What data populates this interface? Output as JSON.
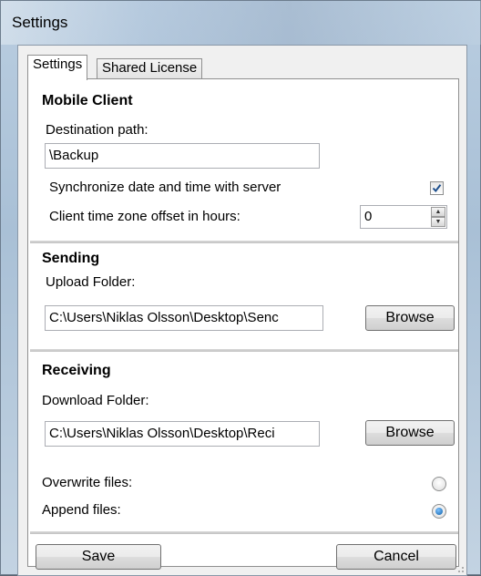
{
  "window": {
    "title": "Settings"
  },
  "tabs": [
    {
      "label": "Settings",
      "active": true
    },
    {
      "label": "Shared License",
      "active": false
    }
  ],
  "mobile_client": {
    "heading": "Mobile Client",
    "destination_label": "Destination path:",
    "destination_value": "\\Backup",
    "sync_label": "Synchronize date and time with server",
    "sync_checked": true,
    "offset_label": "Client time zone offset in hours:",
    "offset_value": "0"
  },
  "sending": {
    "heading": "Sending",
    "upload_label": "Upload Folder:",
    "upload_value": "C:\\Users\\Niklas Olsson\\Desktop\\Senc",
    "browse_label": "Browse"
  },
  "receiving": {
    "heading": "Receiving",
    "download_label": "Download Folder:",
    "download_value": "C:\\Users\\Niklas Olsson\\Desktop\\Reci",
    "browse_label": "Browse",
    "overwrite_label": "Overwrite files:",
    "append_label": "Append files:",
    "selected_mode": "append"
  },
  "footer": {
    "save_label": "Save",
    "cancel_label": "Cancel"
  },
  "colors": {
    "radio_selected": "#0d5ea8",
    "check_mark": "#1c4e8c"
  }
}
